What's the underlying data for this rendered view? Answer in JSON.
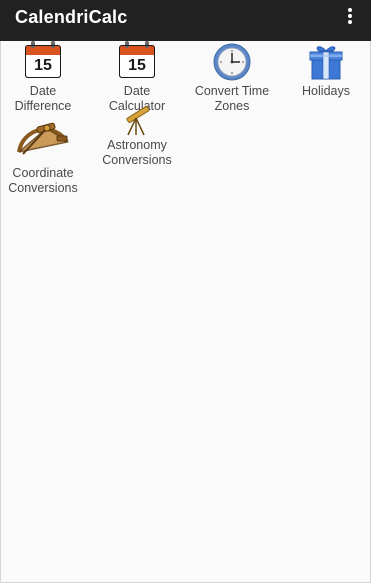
{
  "app": {
    "title": "CalendriCalc"
  },
  "menu": {
    "icon": "overflow-menu-icon"
  },
  "tiles": [
    {
      "label_line1": "Date",
      "label_line2": "Difference",
      "icon": "calendar-icon",
      "icon_text": "15"
    },
    {
      "label_line1": "Date",
      "label_line2": "Calculator",
      "icon": "calendar-icon",
      "icon_text": "15"
    },
    {
      "label_line1": "Convert Time",
      "label_line2": "Zones",
      "icon": "clock-icon"
    },
    {
      "label_line1": "Holidays",
      "label_line2": "",
      "icon": "gift-icon"
    },
    {
      "label_line1": "Coordinate",
      "label_line2": "Conversions",
      "icon": "sextant-icon"
    },
    {
      "label_line1": "Astronomy",
      "label_line2": "Conversions",
      "icon": "telescope-icon"
    }
  ],
  "colors": {
    "appbar": "#212121",
    "background": "#fafafa",
    "calendar_header": "#d9531e",
    "clock_blue": "#5b87c7",
    "gift_blue": "#3d78d6",
    "sextant_brown": "#8a5a1e",
    "telescope_gold": "#d8a23a"
  }
}
